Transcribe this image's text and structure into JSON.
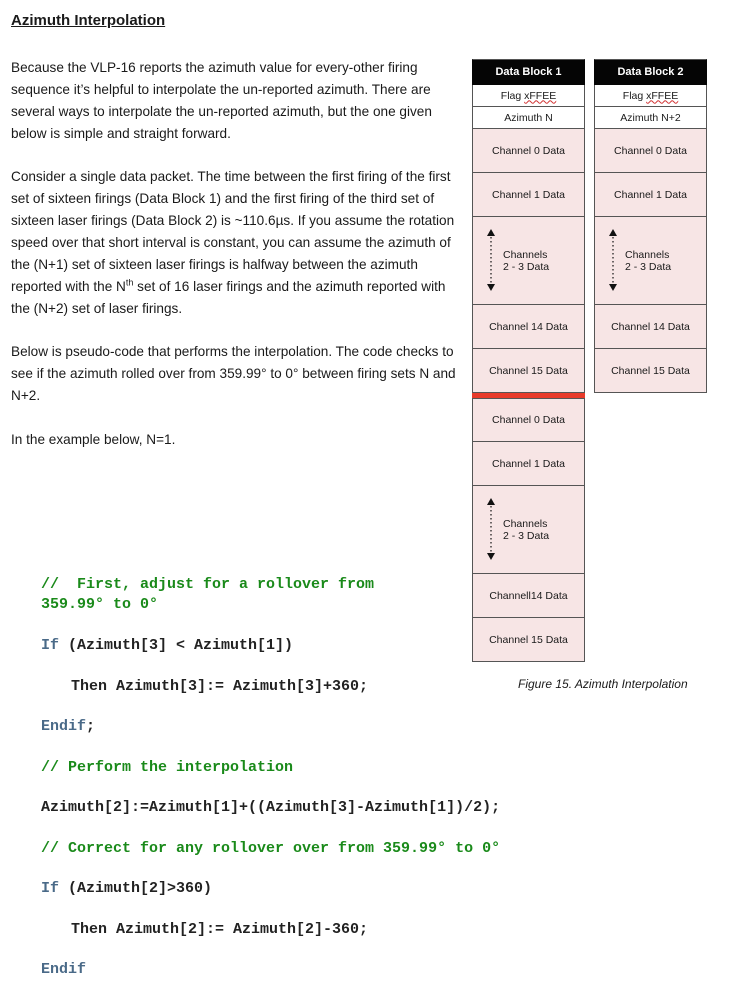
{
  "doc": {
    "title": "Azimuth Interpolation",
    "p1": "Because the VLP-16 reports the azimuth value for every-other firing sequence it’s helpful to interpolate the un-reported azimuth. There are several ways to interpolate the un-reported azimuth, but the one given below is simple and straight forward.",
    "p2_a": "Consider a single data packet. The time between the first firing of the first set of sixteen firings (Data Block 1) and the first firing of the third set of sixteen laser firings (Data Block 2) is ~110.6µs. If you assume the rotation speed over that short interval is constant, you can assume the azimuth of the (N+1) set of sixteen laser firings is halfway between the azimuth reported with the N",
    "p2_sup": "th",
    "p2_b": " set of 16 laser firings and the azimuth reported with the (N+2) set of laser firings.",
    "p3": "Below is pseudo-code that performs the interpolation. The code checks to see if the azimuth rolled over from 359.99° to 0° between firing sets N and N+2.",
    "p4": "In the example below, N=1."
  },
  "code": {
    "comment1": "//  First, adjust for a rollover from\n359.99° to 0°",
    "if1_kw": "If",
    "if1_cond": " (Azimuth[3] < Azimuth[1])",
    "then1": "Then Azimuth[3]:= Azimuth[3]+360;",
    "endif1_kw": "Endif",
    "endif1_semi": ";",
    "comment2": "// Perform the interpolation",
    "interp": "Azimuth[2]:=Azimuth[1]+((Azimuth[3]-Azimuth[1])/2);",
    "comment3": "// Correct for any rollover over from 359.99° to 0°",
    "if2_kw": "If",
    "if2_cond": " (Azimuth[2]>360)",
    "then2": "Then Azimuth[2]:= Azimuth[2]-360;",
    "endif2_kw": "Endif"
  },
  "figure": {
    "caption": "Figure 15. Azimuth Interpolation",
    "block1": {
      "header": "Data Block 1",
      "flag_prefix": "Flag ",
      "flag_value": "xFFEE",
      "azimuth": "Azimuth N",
      "rows": [
        "Channel 0 Data",
        "Channel 1 Data",
        "Channels\n2 - 3 Data",
        "Channel 14 Data",
        "Channel 15 Data"
      ],
      "rows2": [
        "Channel 0 Data",
        "Channel 1 Data",
        "Channels\n2 - 3 Data",
        "Channell14 Data",
        "Channel 15 Data"
      ]
    },
    "block2": {
      "header": "Data Block 2",
      "flag_prefix": "Flag ",
      "flag_value": "xFFEE",
      "azimuth": "Azimuth N+2",
      "rows": [
        "Channel 0 Data",
        "Channel 1 Data",
        "Channels\n2 - 3 Data",
        "Channel 14 Data",
        "Channel 15 Data"
      ]
    },
    "colors": {
      "header_bg": "#050505",
      "cell_bg": "#f7e5e5",
      "divider": "#e83a2a"
    }
  }
}
